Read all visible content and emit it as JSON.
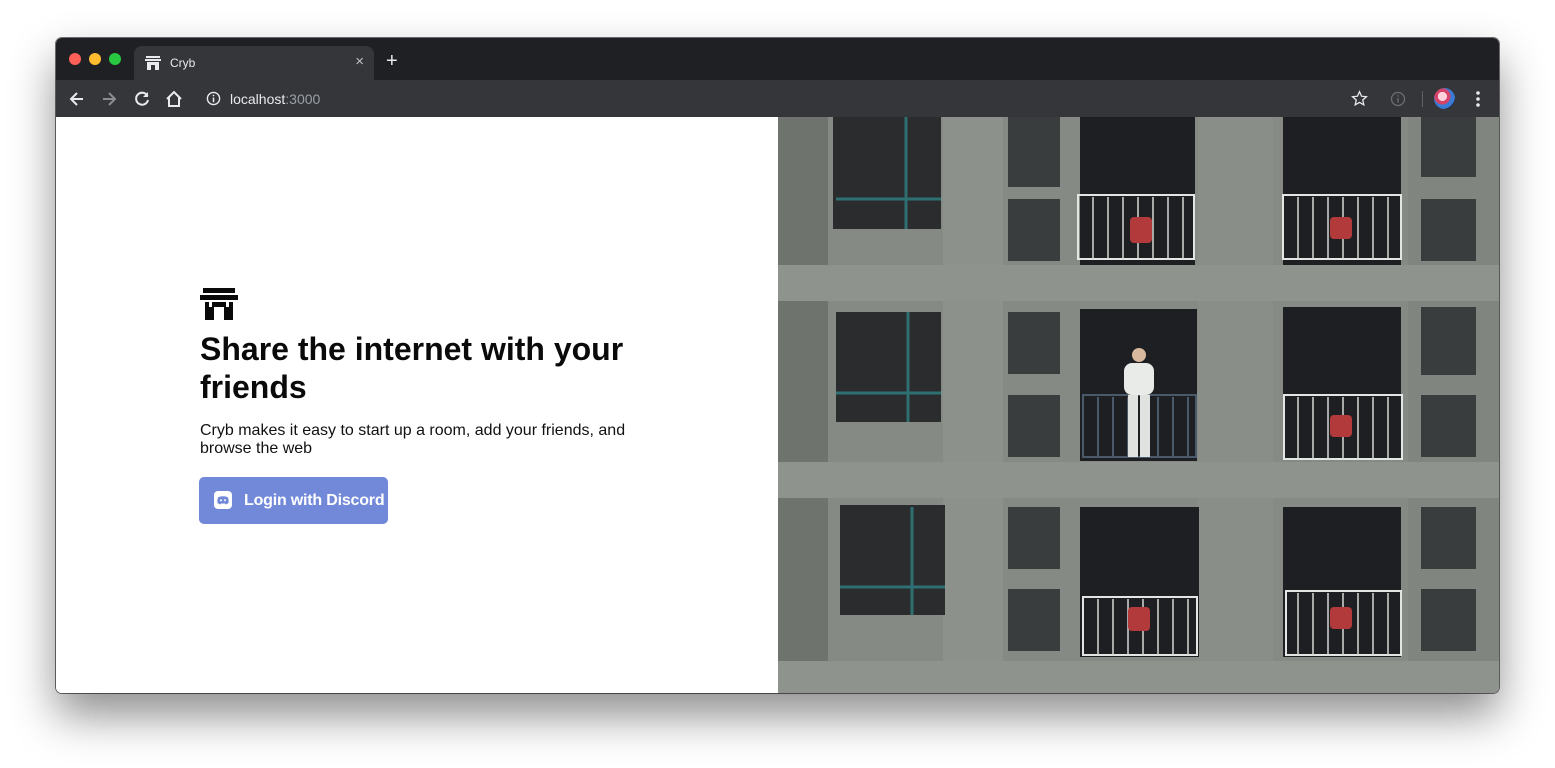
{
  "browser": {
    "tab": {
      "title": "Cryb",
      "close_glyph": "×",
      "favicon": "cryb-logo-icon"
    },
    "new_tab_glyph": "+",
    "url": {
      "host": "localhost",
      "port": ":3000"
    }
  },
  "page": {
    "headline": "Share the internet with your friends",
    "subtitle": "Cryb makes it easy to start up a room, add your friends, and browse the web",
    "login_button": {
      "label": "Login with Discord",
      "color": "#7289da"
    }
  },
  "colors": {
    "tabstrip": "#1f2023",
    "toolbar": "#35363a",
    "accent": "#7289da"
  }
}
